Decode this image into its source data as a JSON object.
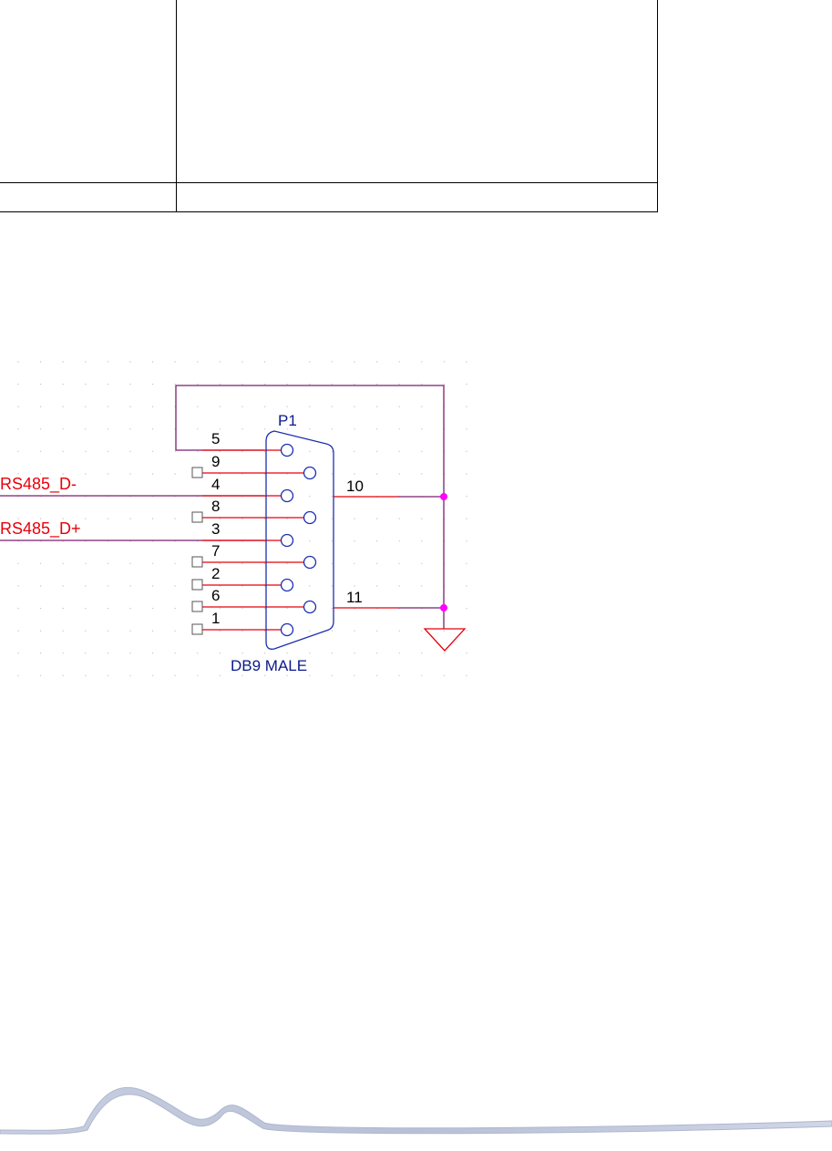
{
  "table": {
    "rows": [
      {
        "cells": [
          "",
          ""
        ]
      },
      {
        "cells": [
          "",
          ""
        ]
      }
    ]
  },
  "schematic": {
    "part_ref": "P1",
    "part_name": "DB9 MALE",
    "nets": {
      "d_minus": "RS485_D-",
      "d_plus": "RS485_D+"
    },
    "pins_left": [
      "5",
      "9",
      "4",
      "8",
      "3",
      "7",
      "2",
      "6",
      "1"
    ],
    "pins_right": [
      "10",
      "11"
    ],
    "colors": {
      "wire": "#e8000b",
      "net_line": "#7a1f6e",
      "part": "#1c2fb0",
      "label_text": "#e8000b",
      "part_text": "#0b1a8a",
      "junction": "#ff00ff",
      "ground": "#e8000b",
      "grid": "#c8c8c8"
    }
  }
}
